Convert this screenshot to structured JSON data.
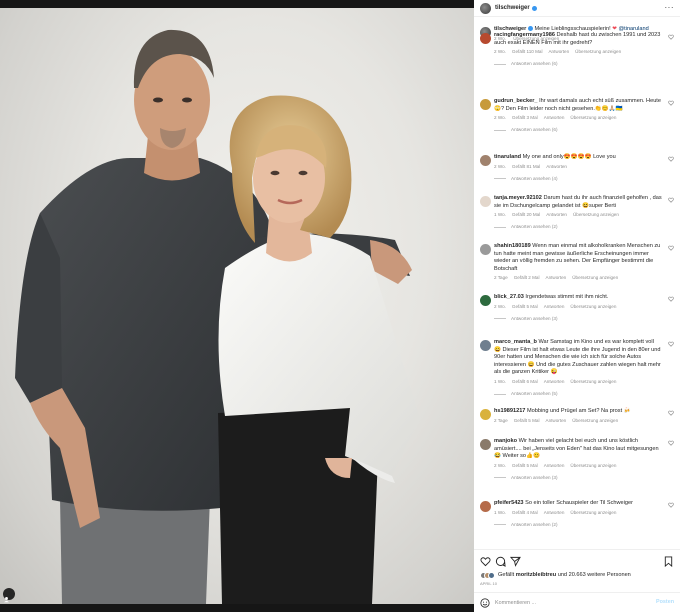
{
  "post": {
    "username": "tilschweiger",
    "caption": {
      "user": "tilschweiger",
      "text": "Meine Lieblingsschauspielerin!",
      "mention": "@tinaruland",
      "time": "2 Wo.",
      "translate": "Übersetzung anzeigen"
    }
  },
  "comments": [
    {
      "user": "racingfangermany1986",
      "text": "Deshalb hast du zwischen 1991 und 2023 auch exakt EINEN Film mit ihr gedreht?",
      "time": "2 Wo.",
      "likes": "Gefällt 110 Mal",
      "reply": "Antworten",
      "translate": "Übersetzung anzeigen",
      "replies": "Antworten ansehen (6)",
      "avatar_color": "#b74a2f"
    },
    {
      "user": "gudrun_becker_",
      "text": "Ihr wart damals auch echt süß zusammen. Heute🙄? Den Film leider noch nicht gesehen.👏😊🙏🏼🇺🇦",
      "time": "2 Wo.",
      "likes": "Gefällt 3 Mal",
      "reply": "Antworten",
      "translate": "Übersetzung anzeigen",
      "replies": "Antworten ansehen (6)",
      "avatar_color": "#c79a3a"
    },
    {
      "user": "tinaruland",
      "text": "My one and only😍😍😍😍 Love you",
      "time": "2 Wo.",
      "likes": "Gefällt 81 Mal",
      "reply": "Antworten",
      "translate": "",
      "replies": "Antworten ansehen (4)",
      "avatar_color": "#a0826d"
    },
    {
      "user": "tanja.meyer.92102",
      "text": "Darum hast du ihr auch finanziell geholfen , das sie im Dschungelcamp gelandet ist 😆super Berti",
      "time": "1 Wo.",
      "likes": "Gefällt 20 Mal",
      "reply": "Antworten",
      "translate": "Übersetzung anzeigen",
      "replies": "Antworten ansehen (2)",
      "avatar_color": "#e3d7cc"
    },
    {
      "user": "shahin180189",
      "text": "Wenn man einmal mit alkoholkranken Menschen zu tun hatte meint man gewisse äußerliche Erscheinungen immer wieder an völlig fremden zu sehen. Der Empfänger bestimmt die Botschaft",
      "time": "2 Tage",
      "likes": "Gefällt 2 Mal",
      "reply": "Antworten",
      "translate": "Übersetzung anzeigen",
      "replies": "",
      "avatar_color": "#9a9a9a"
    },
    {
      "user": "blick_27.03",
      "text": "Irgendetwas stimmt mit ihm nicht.",
      "time": "2 Wo.",
      "likes": "Gefällt 5 Mal",
      "reply": "Antworten",
      "translate": "Übersetzung anzeigen",
      "replies": "Antworten ansehen (3)",
      "avatar_color": "#2d6a3e"
    },
    {
      "user": "marco_manta_b",
      "text": "War Samstag im Kino und es war komplett voll 😄 Dieser Film ist halt etwas Leute die ihre Jugend in den 80er und 90er hatten und Menschen die wie ich sich für solche Autos interessieren 😄 Und die gutes Zuschauer zahlen wiegen halt mehr als die ganzen Kritiker 😜",
      "time": "1 Wo.",
      "likes": "Gefällt 6 Mal",
      "reply": "Antworten",
      "translate": "Übersetzung anzeigen",
      "replies": "Antworten ansehen (5)",
      "avatar_color": "#6f7f8f"
    },
    {
      "user": "hs19891217",
      "text": "Mobbing und Prügel am Set? Na prost 🍻",
      "time": "2 Tage",
      "likes": "Gefällt 5 Mal",
      "reply": "Antworten",
      "translate": "Übersetzung anzeigen",
      "replies": "",
      "avatar_color": "#d9b23c"
    },
    {
      "user": "manjoko",
      "text": "Wir haben viel gelacht bei euch und uns köstlich amüsiert.... bei „Jenseits von Eden\" hat das Kino laut mitgesungen😂 Weiter so👍😊",
      "time": "2 Wo.",
      "likes": "Gefällt 5 Mal",
      "reply": "Antworten",
      "translate": "Übersetzung anzeigen",
      "replies": "Antworten ansehen (3)",
      "avatar_color": "#8a7a6a"
    },
    {
      "user": "pfeifer5423",
      "text": "So ein toller Schauspieler der Til Schweiger",
      "time": "1 Wo.",
      "likes": "Gefällt 4 Mal",
      "reply": "Antworten",
      "translate": "Übersetzung anzeigen",
      "replies": "Antworten ansehen (2)",
      "avatar_color": "#b56b4a"
    }
  ],
  "footer": {
    "liked_by_prefix": "Gefällt",
    "liked_by_user": "moritzbleibtreu",
    "liked_by_suffix": "und 20.663 weitere Personen",
    "date": "APRIL 10",
    "comment_placeholder": "Kommentieren ...",
    "post_label": "Posten"
  },
  "colors": {
    "link": "#00376b",
    "meta": "#8e8e8e",
    "verified": "#3897f0",
    "post_button": "#b2dffc"
  },
  "icons": [
    "more-options-icon",
    "verified-icon",
    "heart-icon",
    "comment-icon",
    "share-icon",
    "bookmark-icon",
    "emoji-icon",
    "user-tag-icon"
  ]
}
